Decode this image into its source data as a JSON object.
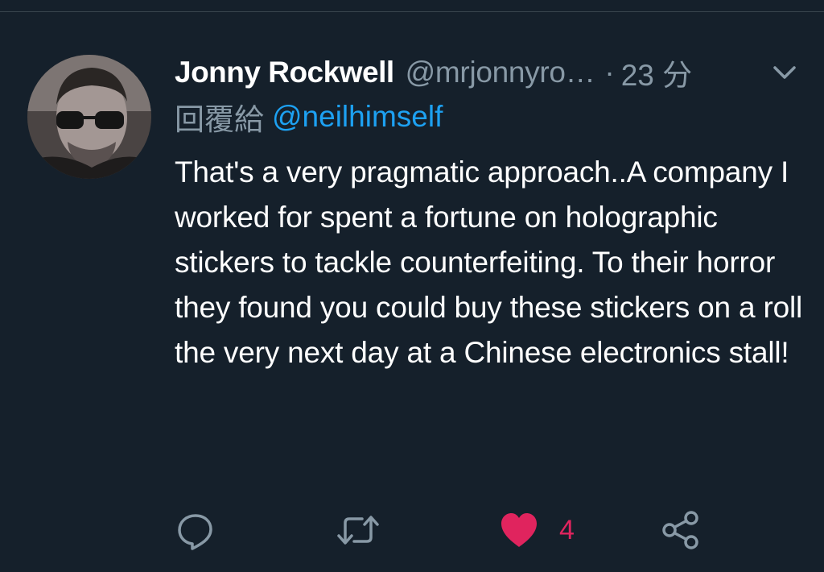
{
  "tweet": {
    "author": {
      "display_name": "Jonny Rockwell",
      "handle": "@mrjonnyro…",
      "avatar_icon": "profile-photo-man-sunglasses"
    },
    "separator": "·",
    "time": "23 分",
    "reply_to": {
      "prefix": "回覆給",
      "mention": "@neilhimself"
    },
    "text": "That's a very pragmatic approach..A company I worked for spent a fortune on holographic stickers to tackle counterfeiting. To their horror they found you could buy these stickers on a roll the very next day at a Chinese electronics stall!",
    "actions": {
      "reply_icon": "reply-icon",
      "retweet_icon": "retweet-icon",
      "like_icon": "heart-icon",
      "like_count": "4",
      "share_icon": "share-icon"
    },
    "colors": {
      "background": "#15202b",
      "secondary_text": "#8899a6",
      "link": "#1da1f2",
      "liked": "#e0245e"
    }
  }
}
